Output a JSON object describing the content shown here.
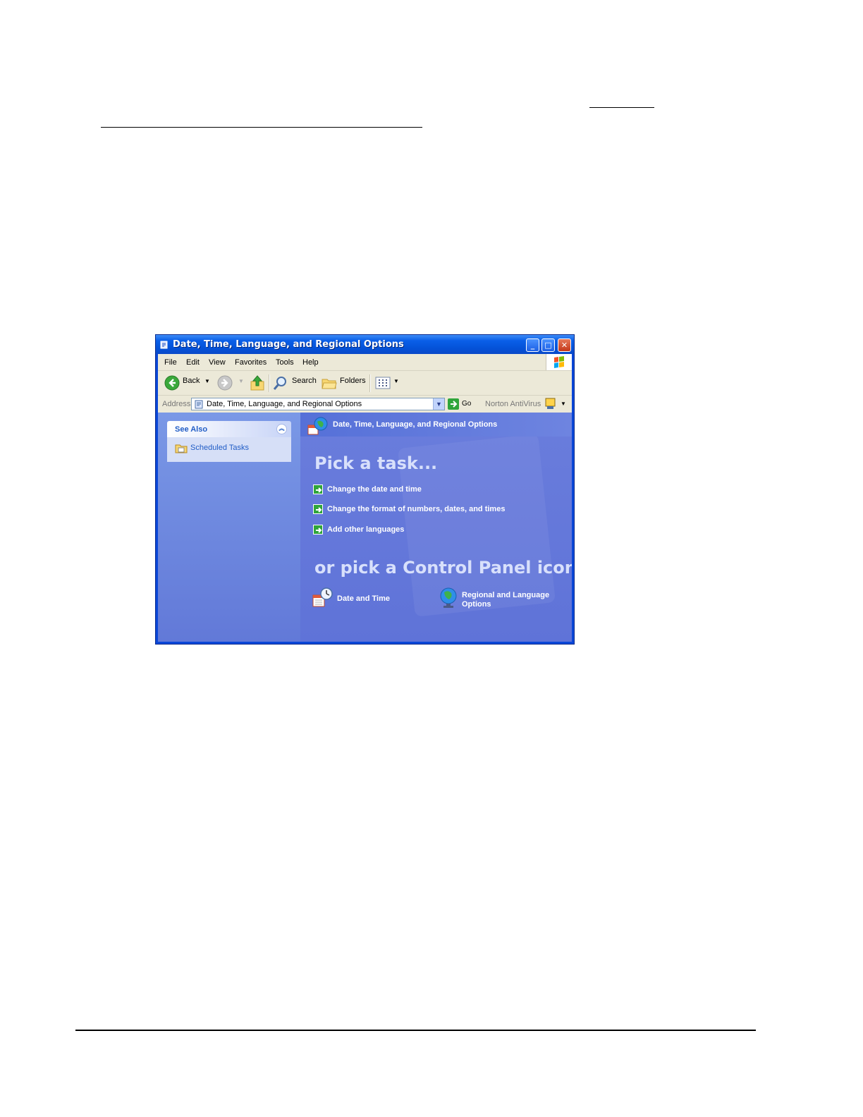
{
  "window": {
    "title": "Date, Time, Language, and Regional Options",
    "menu": [
      "File",
      "Edit",
      "View",
      "Favorites",
      "Tools",
      "Help"
    ],
    "toolbar": {
      "back": "Back",
      "search": "Search",
      "folders": "Folders"
    },
    "address": {
      "label": "Address",
      "value": "Date, Time, Language, and Regional Options",
      "go": "Go",
      "norton": "Norton AntiVirus"
    }
  },
  "sidebar": {
    "see_also_title": "See Also",
    "links": [
      "Scheduled Tasks"
    ]
  },
  "main": {
    "header": "Date, Time, Language, and Regional Options",
    "pick_task": "Pick a task...",
    "tasks": [
      "Change the date and time",
      "Change the format of numbers, dates, and times",
      "Add other languages"
    ],
    "or_pick": "or pick a Control Panel icon",
    "icons": [
      {
        "label": "Date and Time",
        "icon": "date-time-icon"
      },
      {
        "label_line1": "Regional and Language",
        "label_line2": "Options",
        "icon": "globe-icon"
      }
    ]
  },
  "colors": {
    "titlebar": "#0a5fe8",
    "content_bg": "#6b7fdc",
    "task_arrow": "#2fa53a"
  }
}
